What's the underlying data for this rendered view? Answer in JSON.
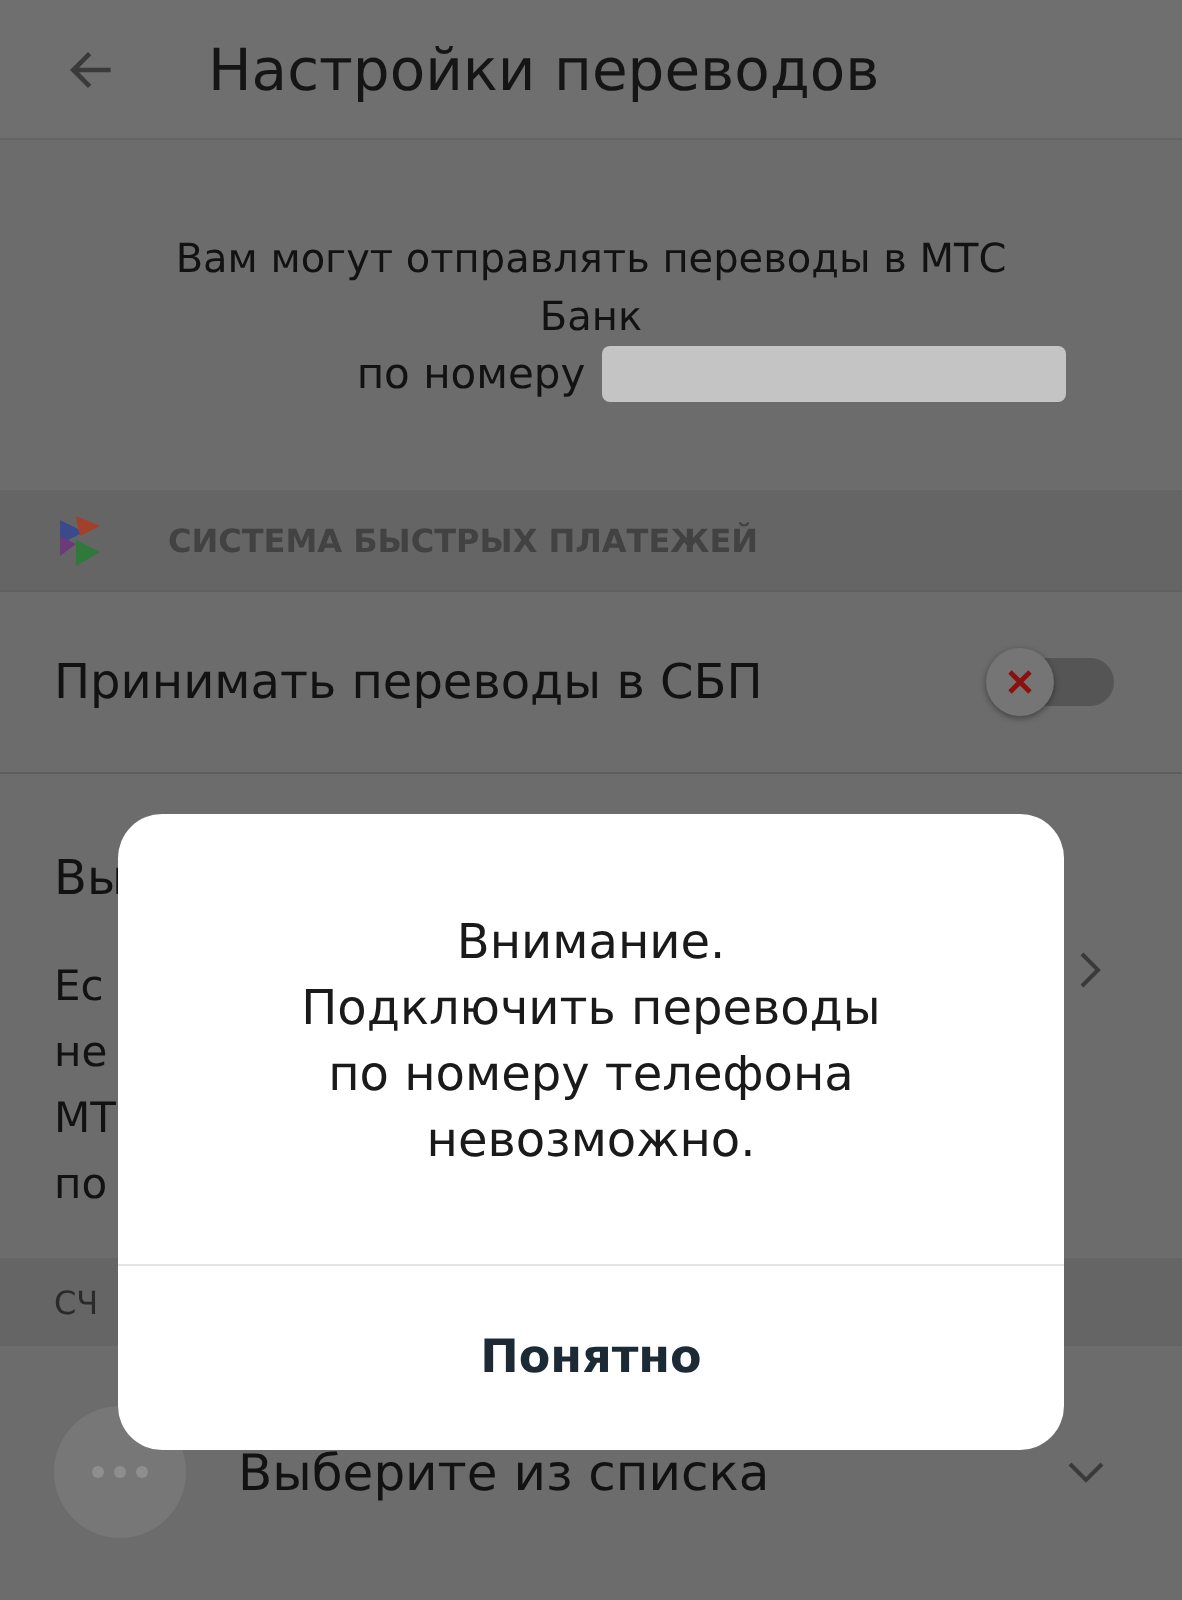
{
  "header": {
    "title": "Настройки переводов"
  },
  "info": {
    "line_1": "Вам могут отправлять переводы в МТС Банк",
    "line_2": "по номеру"
  },
  "sbp_section": {
    "title": "СИСТЕМА БЫСТРЫХ ПЛАТЕЖЕЙ"
  },
  "sbp_toggle": {
    "label": "Принимать переводы в СБП",
    "on": false
  },
  "default_bank": {
    "title": "Вы",
    "description_lines": [
      "Ес",
      "не",
      "МТ",
      "по"
    ]
  },
  "account_section": {
    "title": "СЧ"
  },
  "account_select": {
    "value": "Выберите из списка"
  },
  "dialog": {
    "lines": [
      "Внимание.",
      "Подключить переводы",
      "по номеру телефона",
      "невозможно."
    ],
    "button": "Понятно"
  }
}
